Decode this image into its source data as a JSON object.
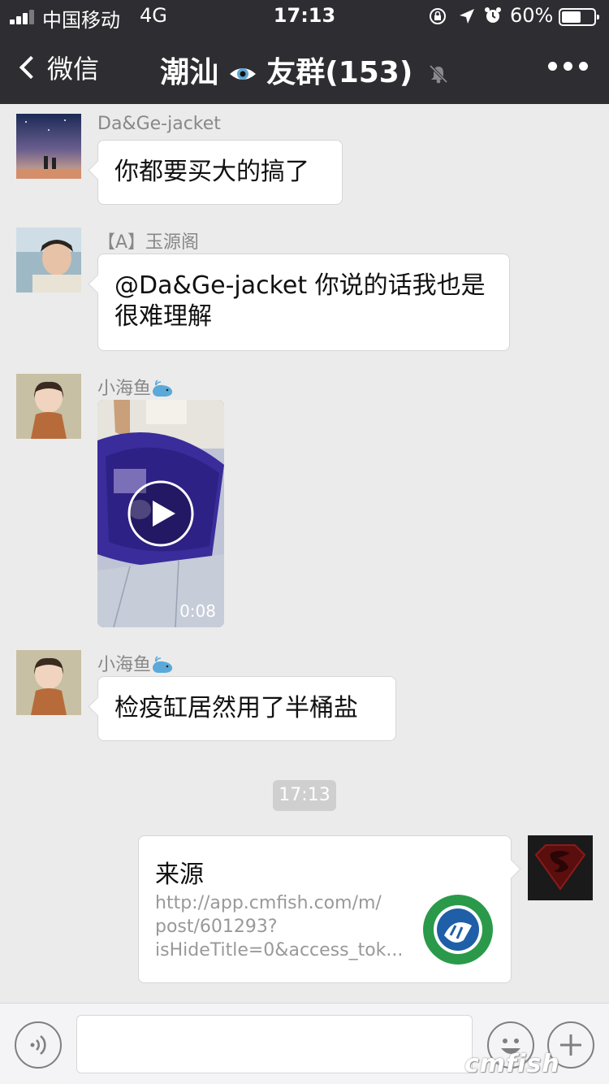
{
  "status_bar": {
    "carrier": "中国移动",
    "network": "4G",
    "time": "17:13",
    "battery_percent": "60%",
    "battery_level": 0.6,
    "icons": [
      "orientation-lock-icon",
      "location-arrow-icon",
      "alarm-icon"
    ]
  },
  "nav": {
    "back_label": "微信",
    "title_part1": "潮汕",
    "title_part2": "友群(153)",
    "icons": [
      "chevron-left-icon",
      "eye-emoji-icon",
      "muted-bell-icon",
      "more-icon"
    ]
  },
  "messages": [
    {
      "sender": "Da&Ge-jacket",
      "text": "你都要买大的搞了"
    },
    {
      "sender": "【A】玉源阁",
      "text": "@Da&Ge-jacket 你说的话我也是很难理解"
    },
    {
      "sender": "小海鱼",
      "video_duration": "0:08"
    },
    {
      "sender": "小海鱼",
      "text": "检疫缸居然用了半桶盐"
    }
  ],
  "timestamp": "17:13",
  "link_card": {
    "title": "来源",
    "description": "http://app.cmfish.com/m/\npost/601293?\nisHideTitle=0&access_tok..."
  },
  "watermark": "cmfish",
  "colors": {
    "nav_bg": "#2e2e32",
    "chat_bg": "#ebebeb",
    "bubble_bg": "#ffffff",
    "timestamp_bg": "#cfcfcf"
  }
}
